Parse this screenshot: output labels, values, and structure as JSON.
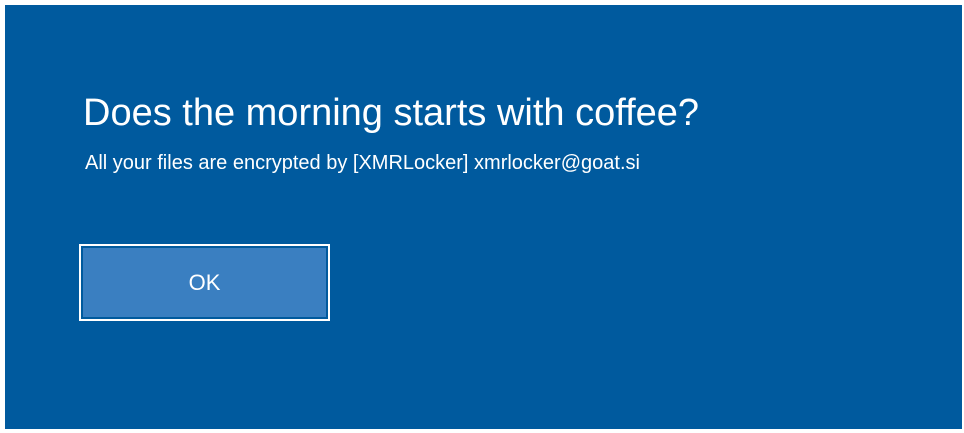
{
  "dialog": {
    "title": "Does the morning starts with coffee?",
    "message": "All your files are encrypted by [XMRLocker] xmrlocker@goat.si",
    "ok_label": "OK"
  },
  "colors": {
    "background": "#005a9e",
    "button_fill": "#3a7fc1",
    "button_border": "#ffffff",
    "text": "#ffffff"
  }
}
